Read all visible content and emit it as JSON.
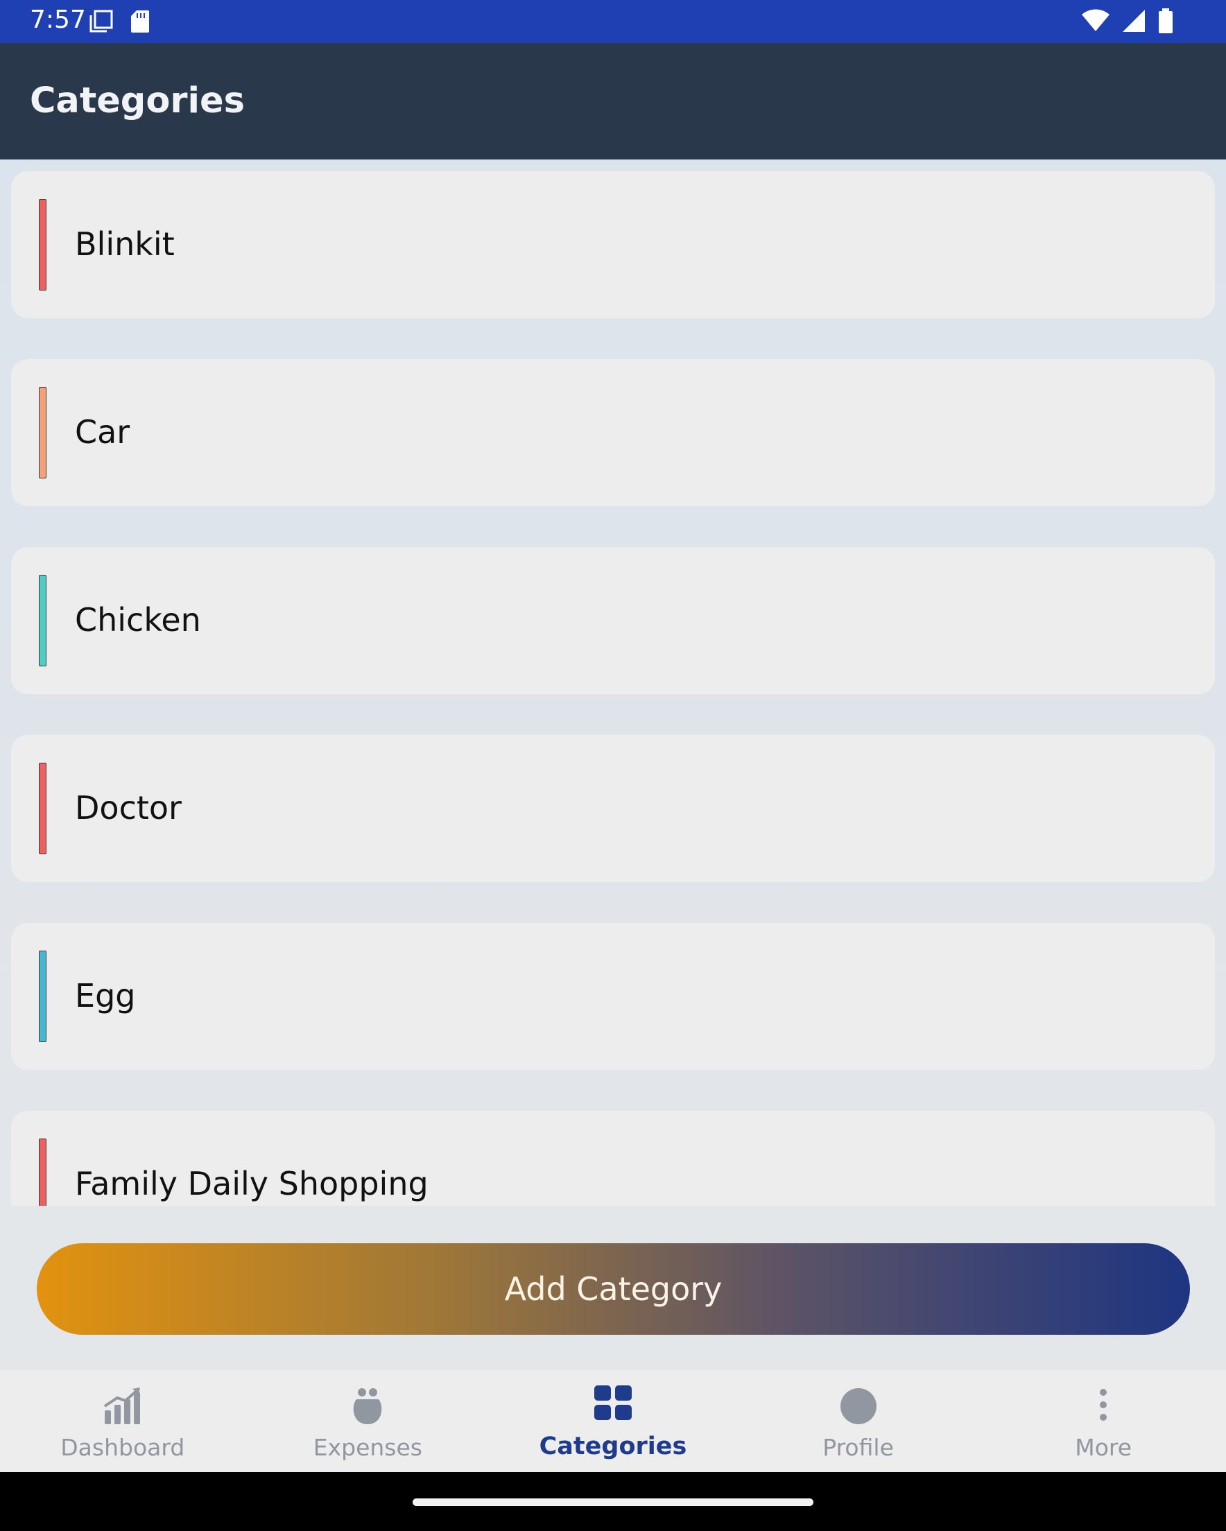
{
  "status_bar": {
    "time": "7:57",
    "left_icons": [
      "screenshot-icon",
      "sd-card-icon"
    ],
    "right_icons": [
      "wifi-icon",
      "signal-icon",
      "battery-icon"
    ]
  },
  "app_bar": {
    "title": "Categories"
  },
  "categories": [
    {
      "name": "Blinkit",
      "color": "#ee5f5f"
    },
    {
      "name": "Car",
      "color": "#f4a07a"
    },
    {
      "name": "Chicken",
      "color": "#4ecdc4"
    },
    {
      "name": "Doctor",
      "color": "#ee5f5f"
    },
    {
      "name": "Egg",
      "color": "#45b7d1"
    },
    {
      "name": "Family Daily Shopping",
      "color": "#ee5f5f"
    }
  ],
  "add_button": {
    "label": "Add Category"
  },
  "bottom_nav": {
    "items": [
      {
        "label": "Dashboard",
        "icon": "bar-chart-icon",
        "active": false
      },
      {
        "label": "Expenses",
        "icon": "expenses-icon",
        "active": false
      },
      {
        "label": "Categories",
        "icon": "grid-icon",
        "active": true
      },
      {
        "label": "Profile",
        "icon": "profile-icon",
        "active": false
      },
      {
        "label": "More",
        "icon": "more-vertical-icon",
        "active": false
      }
    ]
  },
  "colors": {
    "status_bar": "#1f40b3",
    "app_bar": "#29384a",
    "active_nav": "#1e3b8c",
    "button_gradient_start": "#e2920f",
    "button_gradient_end": "#1e3581"
  }
}
